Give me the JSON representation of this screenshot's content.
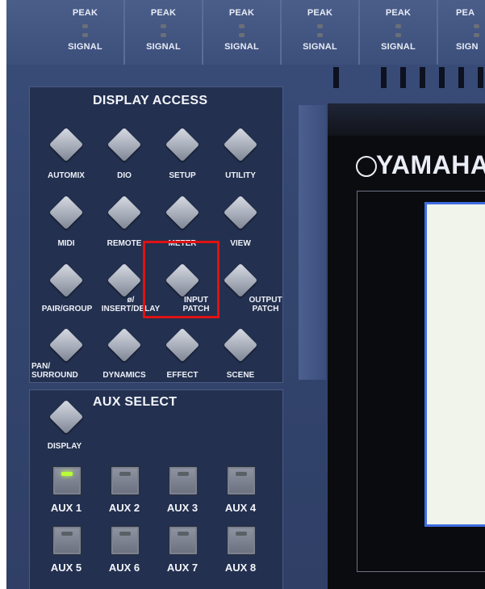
{
  "meters": {
    "channels": [
      {
        "peak": "PEAK",
        "signal": "SIGNAL"
      },
      {
        "peak": "PEAK",
        "signal": "SIGNAL"
      },
      {
        "peak": "PEAK",
        "signal": "SIGNAL"
      },
      {
        "peak": "PEAK",
        "signal": "SIGNAL"
      },
      {
        "peak": "PEAK",
        "signal": "SIGNAL"
      },
      {
        "peak": "PEA",
        "signal": "SIGN"
      }
    ]
  },
  "display_access": {
    "title": "DISPLAY ACCESS",
    "keys": [
      "AUTOMIX",
      "DIO",
      "SETUP",
      "UTILITY",
      "MIDI",
      "REMOTE",
      "METER",
      "VIEW",
      "PAIR/GROUP",
      "ø/\nINSERT/DELAY",
      "INPUT\nPATCH",
      "OUTPUT\nPATCH",
      "PAN/\nSURROUND",
      "DYNAMICS",
      "EFFECT",
      "SCENE"
    ],
    "highlighted": "INPUT\nPATCH"
  },
  "aux_select": {
    "title": "AUX SELECT",
    "display_label": "DISPLAY",
    "buttons": [
      "AUX 1",
      "AUX 2",
      "AUX 3",
      "AUX 4",
      "AUX 5",
      "AUX 6",
      "AUX 7",
      "AUX 8"
    ],
    "active": "AUX 1"
  },
  "brand": "YAMAHA",
  "colors": {
    "highlight": "#e01212",
    "led_on": "#b8ff3a",
    "panel": "#34466f",
    "lcd_border": "#3f6de0"
  }
}
